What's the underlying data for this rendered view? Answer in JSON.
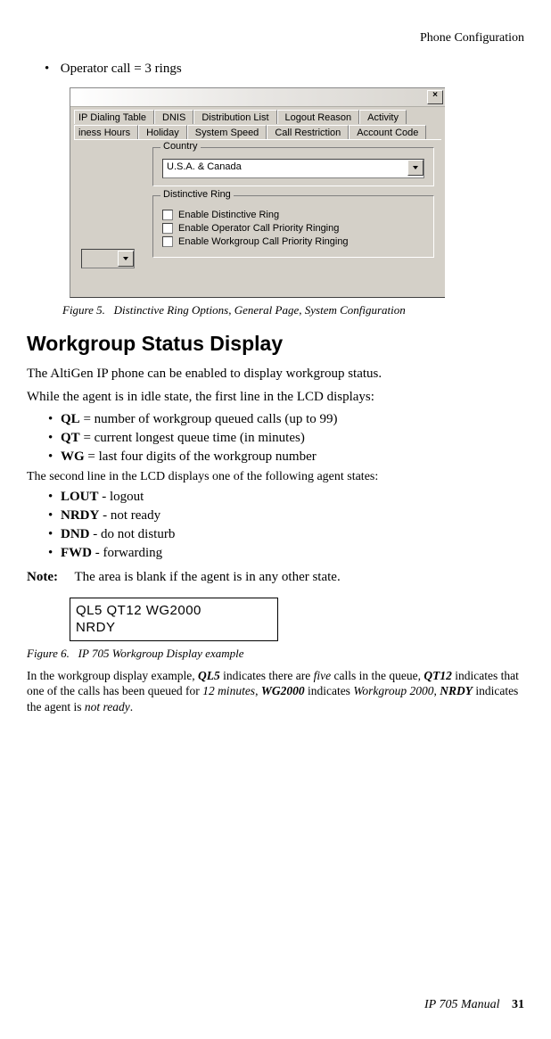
{
  "header": {
    "section": "Phone Configuration"
  },
  "top_bullet": {
    "text": "Operator call = 3 rings"
  },
  "dialog": {
    "tabs_row1": [
      "IP Dialing Table",
      "DNIS",
      "Distribution List",
      "Logout Reason",
      "Activity"
    ],
    "tabs_row2": [
      "iness Hours",
      "Holiday",
      "System Speed",
      "Call Restriction",
      "Account Code"
    ],
    "group_country": {
      "legend": "Country",
      "value": "U.S.A. & Canada"
    },
    "group_ring": {
      "legend": "Distinctive Ring",
      "opt1": "Enable Distinctive Ring",
      "opt2": "Enable Operator Call Priority Ringing",
      "opt3": "Enable Workgroup Call Priority Ringing"
    }
  },
  "figure5": {
    "label": "Figure 5.",
    "text": "Distinctive Ring Options, General Page, System Configuration"
  },
  "section_title": "Workgroup Status Display",
  "p1": "The AltiGen IP phone can be enabled to display workgroup status.",
  "p2": "While the agent is in idle state, the first line in the LCD displays:",
  "list1": {
    "a": {
      "b": "QL",
      "t": " = number of workgroup queued calls (up to 99)"
    },
    "b": {
      "b": "QT",
      "t": " = current longest queue time (in minutes)"
    },
    "c": {
      "b": "WG",
      "t": " = last four digits of the workgroup number"
    }
  },
  "p3": "The second line in the LCD displays one of the following agent states:",
  "list2": {
    "a": {
      "b": "LOUT",
      "t": " - logout"
    },
    "b": {
      "b": "NRDY",
      "t": " - not ready"
    },
    "c": {
      "b": "DND",
      "t": " - do not disturb"
    },
    "d": {
      "b": "FWD",
      "t": " - forwarding"
    }
  },
  "note": {
    "label": "Note:",
    "text": "The area is blank if the agent is in any other state."
  },
  "lcd": {
    "line1": "QL5 QT12 WG2000",
    "line2": "NRDY"
  },
  "figure6": {
    "label": "Figure 6.",
    "text": "IP 705 Workgroup Display example"
  },
  "explain": {
    "pre": "In the workgroup display example, ",
    "b1": "QL5",
    "t1": " indicates there are ",
    "i1": "five",
    "t2": " calls in the queue, ",
    "b2": "QT12",
    "t3": " indicates that one of the calls has been queued for ",
    "i2": "12 minutes",
    "t4": ", ",
    "b3": "WG2000",
    "t5": " indicates ",
    "i3": "Workgroup 2000",
    "t6": ", ",
    "b4": "NRDY",
    "t7": " indicates the agent is ",
    "i4": "not ready",
    "t8": "."
  },
  "footer": {
    "manual": "IP 705 Manual",
    "page": "31"
  }
}
